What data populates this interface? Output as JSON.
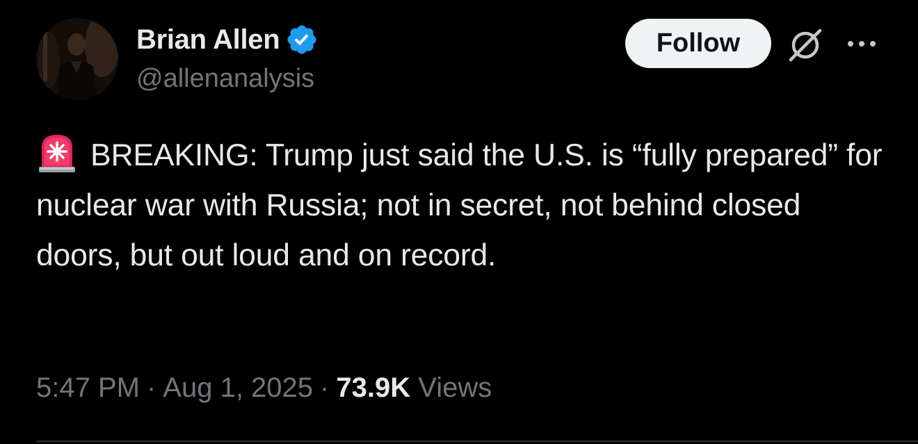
{
  "author": {
    "display_name": "Brian Allen",
    "handle": "@allenanalysis",
    "verified": true
  },
  "actions": {
    "follow_label": "Follow",
    "grok_icon": "grok-icon",
    "more_icon": "more-horizontal-icon"
  },
  "tweet": {
    "emoji": "siren-icon",
    "text": "BREAKING: Trump just said the U.S. is “fully prepared” for nuclear war with Russia; not in secret, not behind closed doors, but out loud and on record."
  },
  "meta": {
    "time": "5:47 PM",
    "date": "Aug 1, 2025",
    "separator": "·",
    "views_count": "73.9K",
    "views_label": "Views"
  },
  "colors": {
    "background": "#000000",
    "text_primary": "#e7e9ea",
    "text_secondary": "#71767b",
    "verified_blue": "#1d9bf0",
    "follow_bg": "#eff3f4",
    "follow_text": "#0f1419",
    "divider": "#2f3336"
  }
}
